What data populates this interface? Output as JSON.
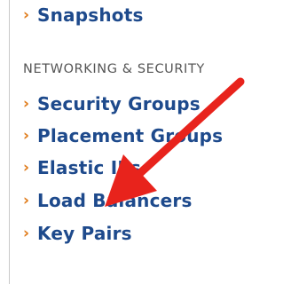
{
  "sidebar": {
    "top_item": {
      "label": "Snapshots"
    },
    "section_heading": "NETWORKING & SECURITY",
    "items": [
      {
        "label": "Security Groups"
      },
      {
        "label": "Placement Groups"
      },
      {
        "label": "Elastic IPs"
      },
      {
        "label": "Load Balancers"
      },
      {
        "label": "Key Pairs"
      }
    ],
    "chevron_glyph": "›"
  },
  "annotation": {
    "arrow_color": "#e8231c",
    "points_to": "Load Balancers"
  },
  "colors": {
    "link": "#1e4a8c",
    "chevron": "#e07b1a",
    "heading": "#555555"
  }
}
